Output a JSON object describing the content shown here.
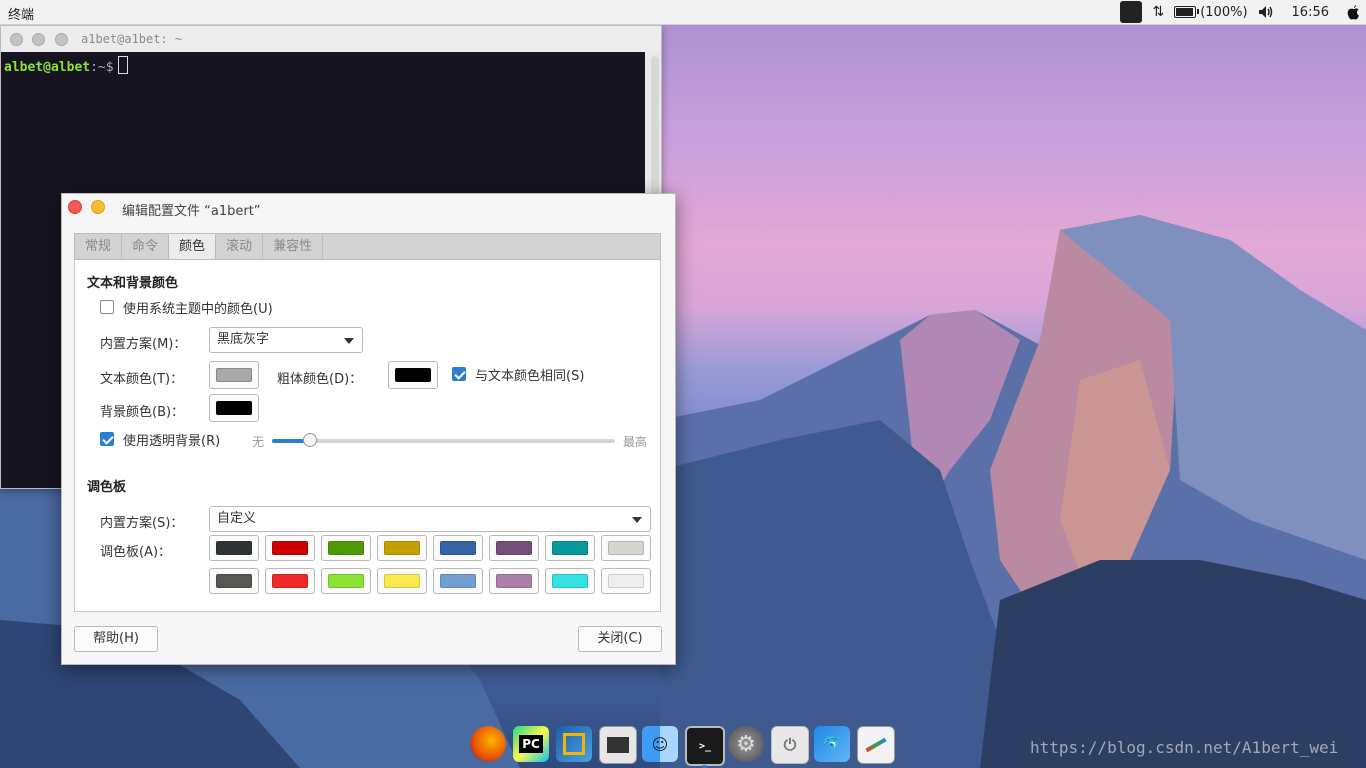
{
  "topbar": {
    "app_name": "终端",
    "battery_label": "(100%)",
    "battery_level": 1.0,
    "time": "16:56",
    "icons": [
      "command-icon",
      "network-icon",
      "battery-icon",
      "volume-icon",
      "apple-icon"
    ]
  },
  "terminal": {
    "title": "a1bet@a1bet: ~",
    "prompt_user": "albet@albet",
    "prompt_path": ":~$"
  },
  "dialog": {
    "title": "编辑配置文件 “a1bert”",
    "tabs": [
      "常规",
      "命令",
      "颜色",
      "滚动",
      "兼容性"
    ],
    "active_tab": "颜色",
    "section_colors": "文本和背景颜色",
    "use_system_theme_label": "使用系统主题中的颜色(U)",
    "use_system_theme_checked": false,
    "builtin_scheme_label": "内置方案(M)：",
    "builtin_scheme_value": "黑底灰字",
    "text_color_label": "文本颜色(T)：",
    "text_color": "#a9a9a9",
    "bold_color_label": "粗体颜色(D)：",
    "bold_color": "#000000",
    "same_as_text_label": "与文本颜色相同(S)",
    "same_as_text_checked": true,
    "bg_color_label": "背景颜色(B)：",
    "bg_color": "#000000",
    "transparent_label": "使用透明背景(R)",
    "transparent_checked": true,
    "slider_min_label": "无",
    "slider_max_label": "最高",
    "transparency_level": 0.11,
    "section_palette": "调色板",
    "palette_scheme_label": "内置方案(S)：",
    "palette_scheme_value": "自定义",
    "palette_label": "调色板(A)：",
    "palette_row1": [
      "#2e3436",
      "#cc0000",
      "#4e9a06",
      "#c4a000",
      "#3465a4",
      "#75507b",
      "#06989a",
      "#d3d7cf"
    ],
    "palette_row2": [
      "#555753",
      "#ef2929",
      "#8ae234",
      "#fce94f",
      "#729fcf",
      "#ad7fa8",
      "#34e2e2",
      "#eeeeec"
    ],
    "help_button": "帮助(H)",
    "close_button": "关闭(C)"
  },
  "dock": {
    "items": [
      "firefox-icon",
      "pycharm-icon",
      "virtualbox-icon",
      "screenshot-icon",
      "finder-icon",
      "terminal-icon",
      "settings-icon",
      "power-icon",
      "mysql-workbench-icon",
      "text-editor-icon"
    ]
  },
  "watermark": "https://blog.csdn.net/A1bert_wei"
}
